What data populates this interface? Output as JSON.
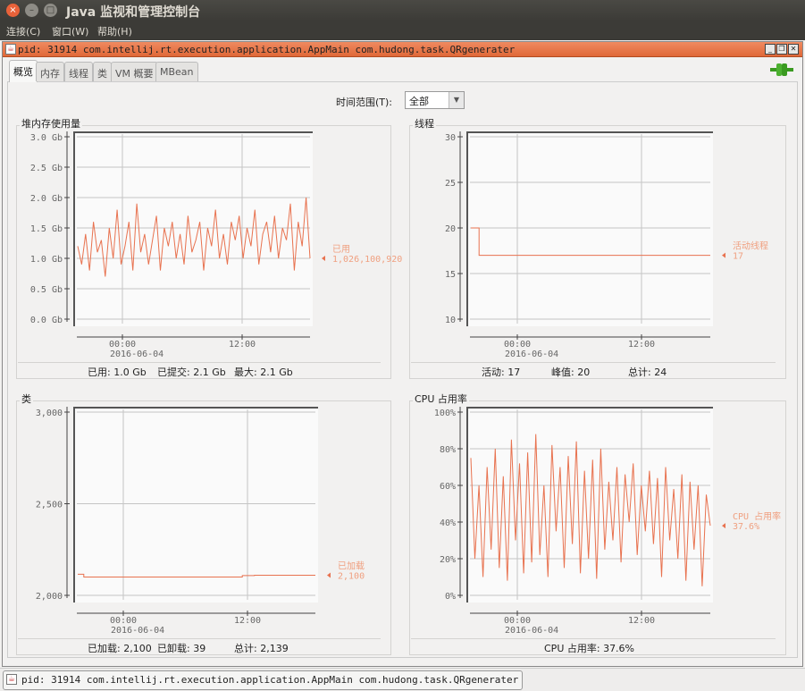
{
  "window": {
    "title": "Java 监视和管理控制台"
  },
  "menu": [
    "连接(C)",
    "窗口(W)",
    "帮助(H)"
  ],
  "internal_frame": {
    "title": "pid: 31914 com.intellij.rt.execution.application.AppMain com.hudong.task.QRgenerater"
  },
  "tabs": [
    {
      "label": "概览",
      "active": true
    },
    {
      "label": "内存"
    },
    {
      "label": "线程"
    },
    {
      "label": "类"
    },
    {
      "label": "VM 概要"
    },
    {
      "label": "MBean"
    }
  ],
  "time_range": {
    "label": "时间范围(T):",
    "value": "全部"
  },
  "colors": {
    "series": "#e8724f",
    "label": "#f0a080",
    "frame_title": "#e8784a",
    "connection": "#3a9a20"
  },
  "x_ticks": [
    {
      "label": "00:00",
      "sub": "2016-06-04"
    },
    {
      "label": "12:00",
      "sub": ""
    }
  ],
  "panels": {
    "heap": {
      "title": "堆内存使用量",
      "y_ticks": [
        "3.0 Gb",
        "2.5 Gb",
        "2.0 Gb",
        "1.5 Gb",
        "1.0 Gb",
        "0.5 Gb",
        "0.0 Gb"
      ],
      "ylim": [
        0,
        3
      ],
      "legend_name": "已用",
      "legend_value": "1,026,100,920",
      "summary": [
        "已用: 1.0 Gb",
        "已提交: 2.1 Gb",
        "最大: 2.1 Gb"
      ],
      "values": [
        1.2,
        0.9,
        1.4,
        0.8,
        1.6,
        1.1,
        1.3,
        0.7,
        1.5,
        1.0,
        1.8,
        0.9,
        1.2,
        1.6,
        0.8,
        1.9,
        1.1,
        1.4,
        0.9,
        1.3,
        1.7,
        0.8,
        1.5,
        1.2,
        1.6,
        1.0,
        1.4,
        0.9,
        1.7,
        1.1,
        1.3,
        1.6,
        0.8,
        1.5,
        1.2,
        1.8,
        1.0,
        1.4,
        0.9,
        1.6,
        1.3,
        1.7,
        1.0,
        1.5,
        1.2,
        1.8,
        0.9,
        1.4,
        1.6,
        1.1,
        1.7,
        1.0,
        1.5,
        1.3,
        1.9,
        0.8,
        1.6,
        1.2,
        2.0,
        1.0
      ]
    },
    "threads": {
      "title": "线程",
      "y_ticks": [
        "30",
        "25",
        "20",
        "15",
        "10"
      ],
      "ylim": [
        10,
        30
      ],
      "legend_name": "活动线程",
      "legend_value": "17",
      "summary": [
        "活动: 17",
        "峰值: 20",
        "总计: 24"
      ],
      "values": [
        20,
        17,
        17,
        17,
        17,
        17,
        17,
        17,
        17,
        17,
        17,
        17,
        17,
        17,
        17,
        17,
        17,
        17,
        17,
        17,
        17,
        17,
        17,
        17,
        17,
        17,
        17,
        17,
        17,
        17
      ]
    },
    "classes": {
      "title": "类",
      "y_ticks": [
        "3,000",
        "2,500",
        "2,000"
      ],
      "ylim": [
        2000,
        3000
      ],
      "legend_name": "已加载",
      "legend_value": "2,100",
      "summary": [
        "已加载: 2,100",
        "已卸载: 39",
        "总计: 2,139"
      ],
      "values": [
        2115,
        2100,
        2100,
        2100,
        2100,
        2100,
        2100,
        2100,
        2100,
        2100,
        2100,
        2100,
        2100,
        2100,
        2100,
        2100,
        2100,
        2100,
        2100,
        2100,
        2100,
        2100,
        2100,
        2100,
        2100,
        2100,
        2100,
        2108,
        2108,
        2110,
        2110,
        2110,
        2110,
        2110,
        2110,
        2110,
        2110,
        2110,
        2110,
        2110
      ]
    },
    "cpu": {
      "title": "CPU 占用率",
      "y_ticks": [
        "100%",
        "80%",
        "60%",
        "40%",
        "20%",
        "0%"
      ],
      "ylim": [
        0,
        100
      ],
      "legend_name": "CPU 占用率",
      "legend_value": "37.6%",
      "summary": [
        "CPU 占用率: 37.6%"
      ],
      "values": [
        75,
        20,
        60,
        10,
        70,
        25,
        80,
        15,
        65,
        8,
        85,
        30,
        72,
        12,
        78,
        18,
        88,
        22,
        60,
        10,
        82,
        35,
        70,
        15,
        76,
        28,
        84,
        12,
        68,
        20,
        74,
        9,
        80,
        25,
        62,
        30,
        70,
        18,
        66,
        40,
        72,
        22,
        60,
        35,
        68,
        28,
        64,
        10,
        70,
        30,
        58,
        20,
        66,
        8,
        62,
        25,
        60,
        5,
        55,
        38
      ]
    }
  },
  "status": {
    "task": "pid: 31914 com.intellij.rt.execution.application.AppMain com.hudong.task.QRgenerater"
  }
}
